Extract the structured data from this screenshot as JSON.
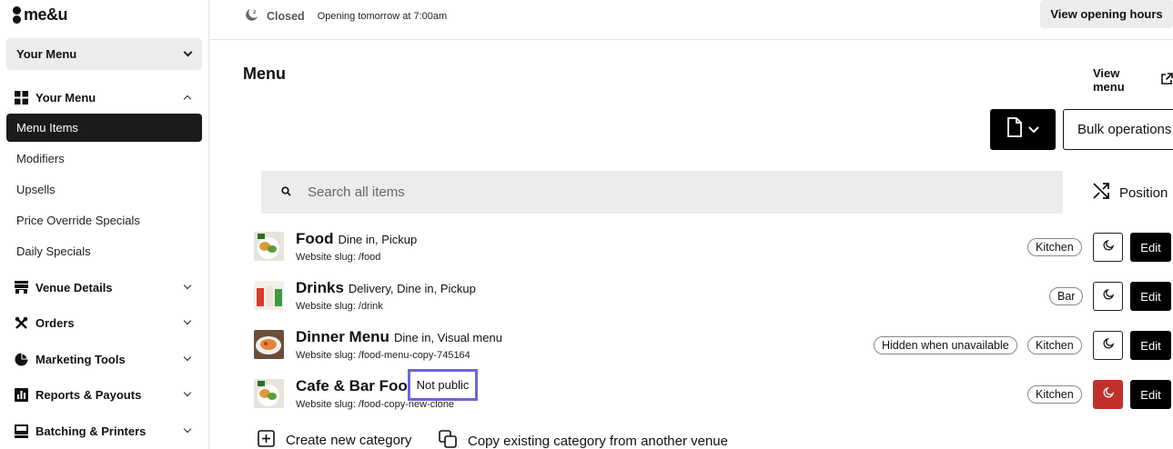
{
  "brand": {
    "logo_text": "me&u"
  },
  "sidebar": {
    "menu_select": "Your Menu",
    "sections": [
      {
        "label": "Your Menu",
        "icon": "grid-icon",
        "expanded": true
      },
      {
        "label": "Venue Details",
        "icon": "store-icon",
        "expanded": false
      },
      {
        "label": "Orders",
        "icon": "cutlery-icon",
        "expanded": false
      },
      {
        "label": "Marketing Tools",
        "icon": "pie-chart-icon",
        "expanded": false
      },
      {
        "label": "Reports & Payouts",
        "icon": "bar-chart-icon",
        "expanded": false
      },
      {
        "label": "Batching & Printers",
        "icon": "printer-icon",
        "expanded": false
      }
    ],
    "menu_items": [
      "Menu Items",
      "Modifiers",
      "Upsells",
      "Price Override Specials",
      "Daily Specials"
    ]
  },
  "topbar": {
    "status_label": "Closed",
    "status_sub": "Opening tomorrow at 7:00am",
    "view_hours": "View opening hours"
  },
  "main": {
    "title": "Menu",
    "view_menu": "View menu",
    "bulk_label": "Bulk operations",
    "search_placeholder": "Search all items",
    "position_label": "Position",
    "categories": [
      {
        "name": "Food",
        "modes": "Dine in, Pickup",
        "slug": "Website slug: /food",
        "tags": [
          "Kitchen"
        ],
        "moon_active": false,
        "edit": "Edit"
      },
      {
        "name": "Drinks",
        "modes": "Delivery, Dine in, Pickup",
        "slug": "Website slug: /drink",
        "tags": [
          "Bar"
        ],
        "moon_active": false,
        "edit": "Edit"
      },
      {
        "name": "Dinner Menu",
        "modes": "Dine in, Visual menu",
        "slug": "Website slug: /food-menu-copy-745164",
        "tags": [
          "Hidden when unavailable",
          "Kitchen"
        ],
        "moon_active": false,
        "edit": "Edit"
      },
      {
        "name": "Cafe & Bar Food",
        "modes": "",
        "slug": "Website slug: /food-copy-new-clone",
        "tags": [
          "Kitchen"
        ],
        "moon_active": true,
        "edit": "Edit"
      }
    ],
    "not_public": "Not public",
    "create_category": "Create new category",
    "copy_category": "Copy existing category from another venue"
  },
  "colors": {
    "accent_dark": "#000000",
    "highlight_box": "#6b66d9",
    "moon_active": "#c0312b"
  }
}
